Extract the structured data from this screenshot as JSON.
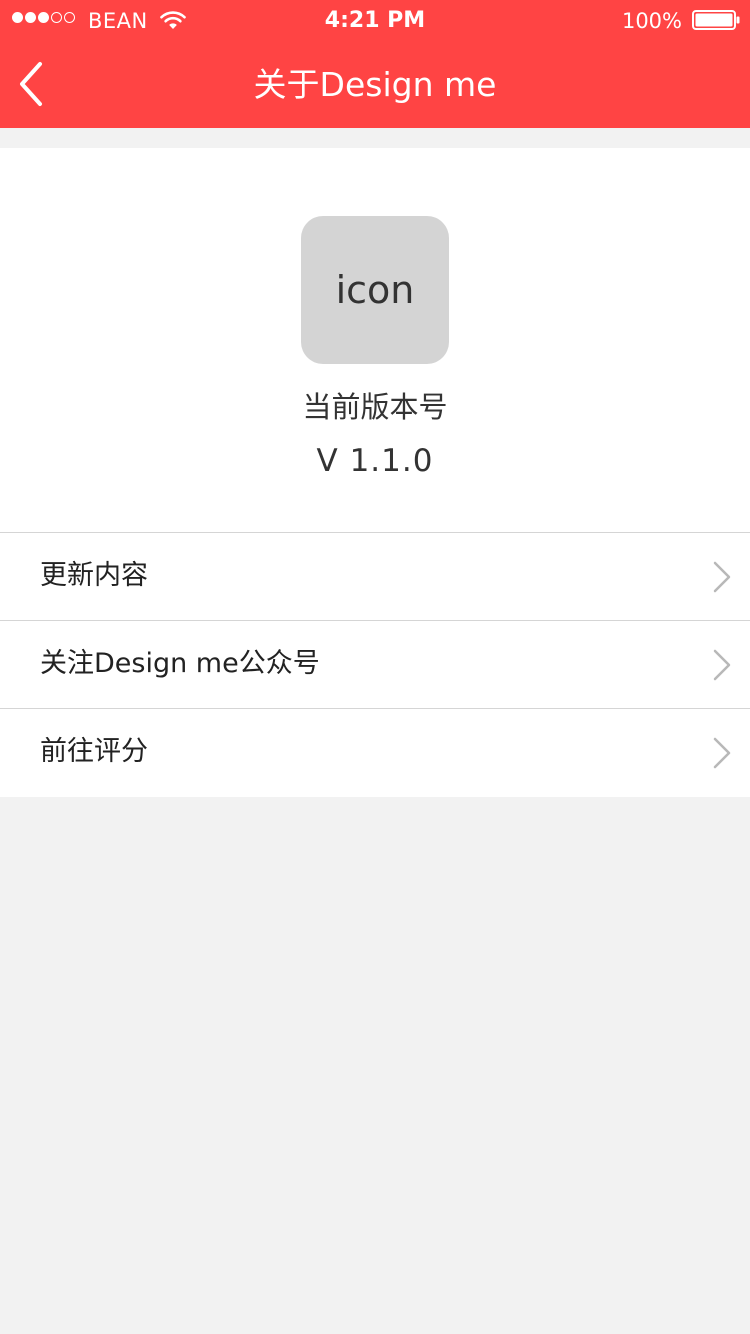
{
  "status_bar": {
    "signal_filled": 3,
    "signal_empty": 2,
    "carrier": "BEAN",
    "time": "4:21 PM",
    "battery_percent": "100%",
    "battery_level": 1.0
  },
  "nav": {
    "title": "关于Design me",
    "back_icon": "chevron-left-icon"
  },
  "app_info": {
    "icon_label": "icon",
    "version_label": "当前版本号",
    "version_value": "V 1.1.0"
  },
  "menu": {
    "items": [
      {
        "label": "更新内容"
      },
      {
        "label": "关注Design me公众号"
      },
      {
        "label": "前往评分"
      }
    ],
    "chevron_icon": "chevron-right-icon"
  },
  "colors": {
    "brand_red": "#ff4444",
    "background": "#f2f2f2",
    "divider": "#d5d5d5",
    "icon_placeholder": "#d4d4d4",
    "chevron": "#b8b8b8"
  }
}
